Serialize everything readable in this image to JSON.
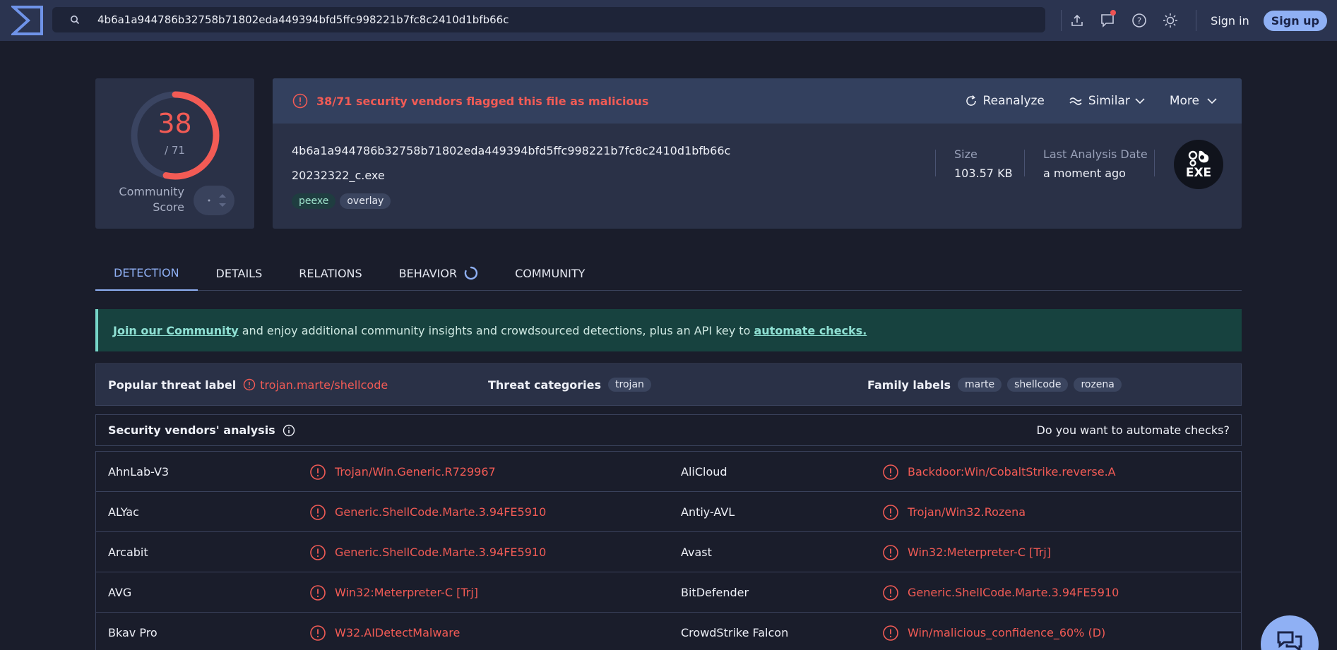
{
  "search": {
    "value": "4b6a1a944786b32758b71802eda449394bfd5ffc998221b7fc8c2410d1bfb66c"
  },
  "top": {
    "signin": "Sign in",
    "signup": "Sign up"
  },
  "score": {
    "value": "38",
    "total": "/ 71",
    "community_line1": "Community",
    "community_line2": "Score"
  },
  "file": {
    "flagged": "38/71 security vendors flagged this file as malicious",
    "reanalyze": "Reanalyze",
    "similar": "Similar",
    "more": "More",
    "hash": "4b6a1a944786b32758b71802eda449394bfd5ffc998221b7fc8c2410d1bfb66c",
    "name": "20232322_c.exe",
    "tags": [
      "peexe",
      "overlay"
    ],
    "size_label": "Size",
    "size_value": "103.57 KB",
    "date_label": "Last Analysis Date",
    "date_value": "a moment ago",
    "type_badge": "EXE"
  },
  "tabs": [
    "DETECTION",
    "DETAILS",
    "RELATIONS",
    "BEHAVIOR",
    "COMMUNITY"
  ],
  "join": {
    "link1": "Join our Community",
    "middle": " and enjoy additional community insights and crowdsourced detections, plus an API key to ",
    "link2": "automate checks."
  },
  "threat": {
    "popular_label": "Popular threat label",
    "popular_value": "trojan.marte/shellcode",
    "categories_label": "Threat categories",
    "categories": [
      "trojan"
    ],
    "family_label": "Family labels",
    "families": [
      "marte",
      "shellcode",
      "rozena"
    ]
  },
  "vendors": {
    "title": "Security vendors' analysis",
    "automate": "Do you want to automate checks?",
    "rows": [
      {
        "v1": "AhnLab-V3",
        "r1": "Trojan/Win.Generic.R729967",
        "v2": "AliCloud",
        "r2": "Backdoor:Win/CobaltStrike.reverse.A"
      },
      {
        "v1": "ALYac",
        "r1": "Generic.ShellCode.Marte.3.94FE5910",
        "v2": "Antiy-AVL",
        "r2": "Trojan/Win32.Rozena"
      },
      {
        "v1": "Arcabit",
        "r1": "Generic.ShellCode.Marte.3.94FE5910",
        "v2": "Avast",
        "r2": "Win32:Meterpreter-C [Trj]"
      },
      {
        "v1": "AVG",
        "r1": "Win32:Meterpreter-C [Trj]",
        "v2": "BitDefender",
        "r2": "Generic.ShellCode.Marte.3.94FE5910"
      },
      {
        "v1": "Bkav Pro",
        "r1": "W32.AIDetectMalware",
        "v2": "CrowdStrike Falcon",
        "r2": "Win/malicious_confidence_60% (D)"
      }
    ]
  },
  "colors": {
    "accent": "#8fb0f4",
    "malicious": "#f25b55",
    "bg": "#1a1d2b",
    "panel": "#2a3147"
  }
}
